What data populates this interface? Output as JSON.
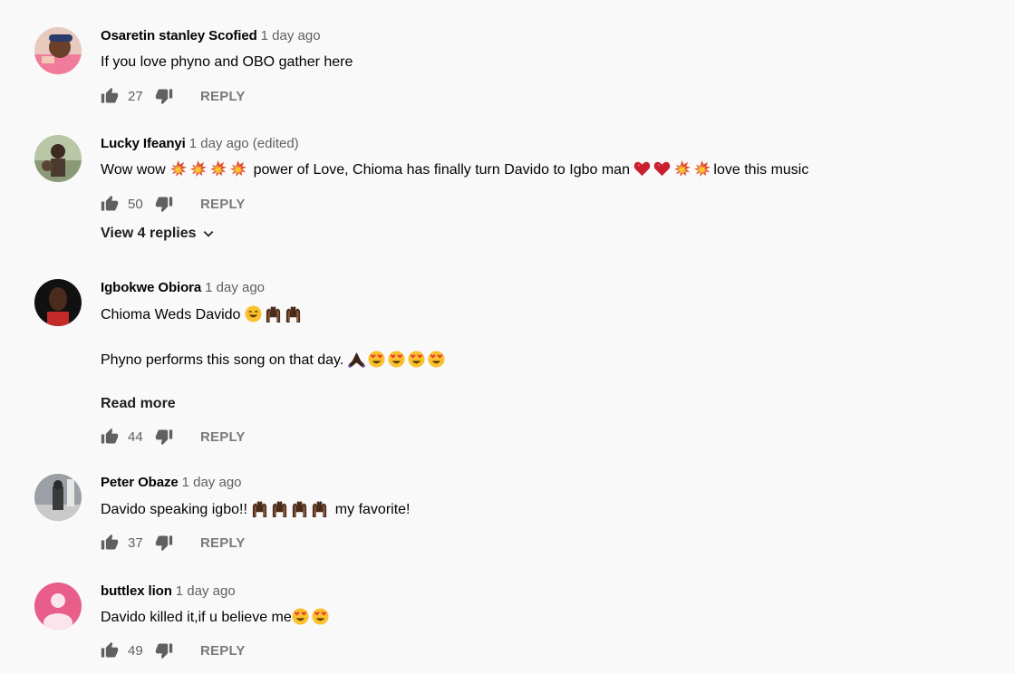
{
  "comments": [
    {
      "author": "Osaretin stanley Scofied",
      "time": "1 day ago",
      "text": "If you love phyno and OBO gather here",
      "likes": "27",
      "reply_label": "REPLY"
    },
    {
      "author": "Lucky Ifeanyi",
      "time": "1 day ago (edited)",
      "text_a": "Wow wow",
      "text_b": "power of Love, Chioma has finally turn Davido to Igbo man",
      "text_c": "love this music",
      "likes": "50",
      "reply_label": "REPLY",
      "view_replies": "View 4 replies"
    },
    {
      "author": "Igbokwe Obiora",
      "time": "1 day ago",
      "text_line1": "Chioma Weds Davido",
      "text_line2": "Phyno performs this song on that day.",
      "read_more": "Read more",
      "likes": "44",
      "reply_label": "REPLY"
    },
    {
      "author": "Peter Obaze",
      "time": "1 day ago",
      "text_a": "Davido speaking igbo!!",
      "text_b": "my favorite!",
      "likes": "37",
      "reply_label": "REPLY"
    },
    {
      "author": "buttlex lion",
      "time": "1 day ago",
      "text": "Davido killed it,if u believe me",
      "likes": "49",
      "reply_label": "REPLY"
    }
  ],
  "colors": {
    "background": "#f9f9f9",
    "secondary_text": "#606060",
    "default_avatar": "#e85d8a"
  },
  "icons": [
    "thumbs-up-icon",
    "thumbs-down-icon",
    "chevron-down-icon",
    "collision-emoji",
    "heart-emoji",
    "smile-emoji",
    "hands-up-emoji",
    "praying-hands-emoji",
    "heart-eyes-emoji"
  ]
}
